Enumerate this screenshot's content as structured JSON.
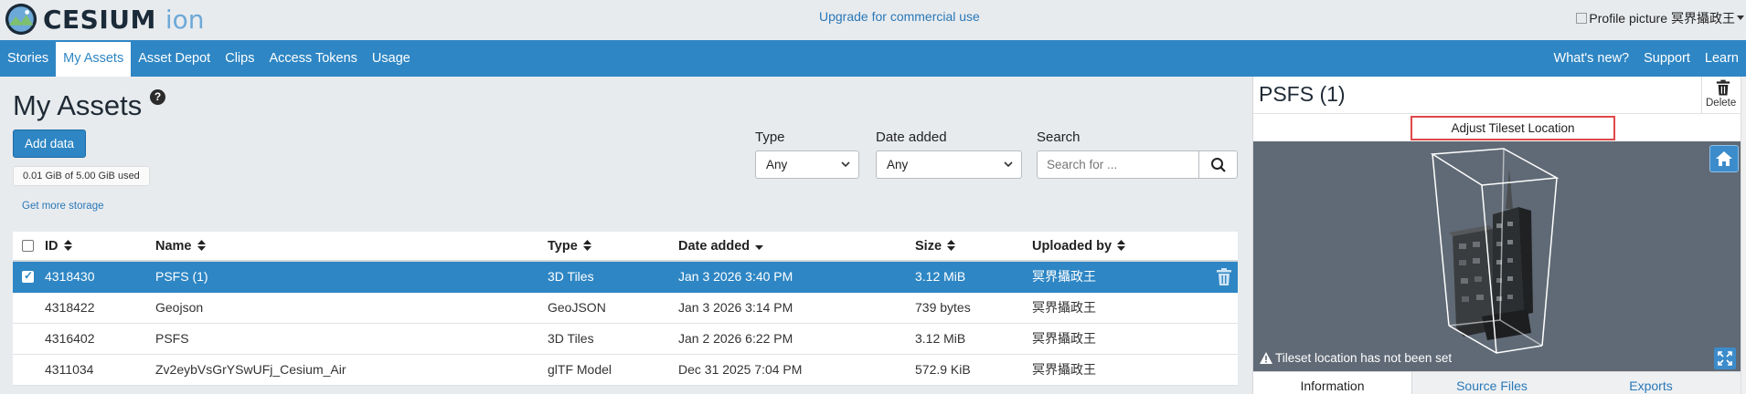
{
  "header": {
    "logo_text": "CESIUM",
    "logo_suffix": "ion",
    "upgrade_link": "Upgrade for commercial use",
    "profile_alt": "Profile picture",
    "profile_name": "冥界攝政王"
  },
  "nav": {
    "left": [
      "Stories",
      "My Assets",
      "Asset Depot",
      "Clips",
      "Access Tokens",
      "Usage"
    ],
    "active": "My Assets",
    "right": [
      "What's new?",
      "Support",
      "Learn"
    ]
  },
  "page": {
    "title": "My Assets",
    "help_glyph": "?",
    "add_button": "Add data",
    "storage_used": "0.01 GiB of 5.00 GiB used",
    "more_storage_link": "Get more storage"
  },
  "filters": {
    "type_label": "Type",
    "type_value": "Any",
    "date_label": "Date added",
    "date_value": "Any",
    "search_label": "Search",
    "search_placeholder": "Search for ..."
  },
  "table": {
    "columns": [
      "ID",
      "Name",
      "Type",
      "Date added",
      "Size",
      "Uploaded by"
    ],
    "sorted_column": "Date added",
    "rows": [
      {
        "id": "4318430",
        "name": "PSFS (1)",
        "type": "3D Tiles",
        "date": "Jan 3 2026 3:40 PM",
        "size": "3.12 MiB",
        "uploader": "冥界攝政王",
        "selected": true
      },
      {
        "id": "4318422",
        "name": "Geojson",
        "type": "GeoJSON",
        "date": "Jan 3 2026 3:14 PM",
        "size": "739 bytes",
        "uploader": "冥界攝政王",
        "selected": false
      },
      {
        "id": "4316402",
        "name": "PSFS",
        "type": "3D Tiles",
        "date": "Jan 2 2026 6:22 PM",
        "size": "3.12 MiB",
        "uploader": "冥界攝政王",
        "selected": false
      },
      {
        "id": "4311034",
        "name": "Zv2eybVsGrYSwUFj_Cesium_Air",
        "type": "glTF Model",
        "date": "Dec 31 2025 7:04 PM",
        "size": "572.9 KiB",
        "uploader": "冥界攝政王",
        "selected": false
      }
    ]
  },
  "detail": {
    "title": "PSFS (1)",
    "delete_label": "Delete",
    "adjust_button": "Adjust Tileset Location",
    "warning": "Tileset location has not been set",
    "tabs": [
      "Information",
      "Source Files",
      "Exports"
    ],
    "active_tab": "Information"
  },
  "colors": {
    "brand_blue": "#2e86c4",
    "link_blue": "#2a78b8",
    "highlight_red": "#e04848",
    "viewer_bg": "#606a76"
  },
  "icons": [
    "cesium-logo-icon",
    "help-icon",
    "chevron-down-icon",
    "search-icon",
    "sort-icon",
    "trash-icon",
    "home-icon",
    "fullscreen-icon",
    "warning-icon"
  ]
}
